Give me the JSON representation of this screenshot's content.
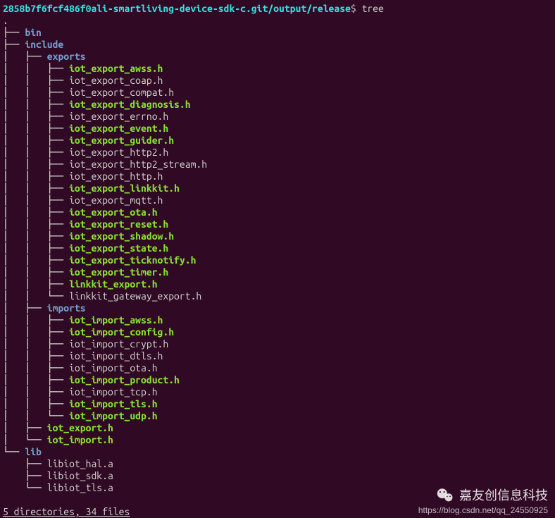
{
  "prompt": {
    "path": "2858b7f6fcf486f0ali-smartliving-device-sdk-c.git/output/release",
    "dollar": "$",
    "command": "tree"
  },
  "dot": ".",
  "tree": [
    {
      "prefix": "├── ",
      "name": "bin",
      "type": "dir"
    },
    {
      "prefix": "├── ",
      "name": "include",
      "type": "dir"
    },
    {
      "prefix": "│   ├── ",
      "name": "exports",
      "type": "dir"
    },
    {
      "prefix": "│   │   ├── ",
      "name": "iot_export_awss.h",
      "type": "file-hl"
    },
    {
      "prefix": "│   │   ├── ",
      "name": "iot_export_coap.h",
      "type": "file"
    },
    {
      "prefix": "│   │   ├── ",
      "name": "iot_export_compat.h",
      "type": "file"
    },
    {
      "prefix": "│   │   ├── ",
      "name": "iot_export_diagnosis.h",
      "type": "file-hl"
    },
    {
      "prefix": "│   │   ├── ",
      "name": "iot_export_errno.h",
      "type": "file"
    },
    {
      "prefix": "│   │   ├── ",
      "name": "iot_export_event.h",
      "type": "file-hl"
    },
    {
      "prefix": "│   │   ├── ",
      "name": "iot_export_guider.h",
      "type": "file-hl"
    },
    {
      "prefix": "│   │   ├── ",
      "name": "iot_export_http2.h",
      "type": "file"
    },
    {
      "prefix": "│   │   ├── ",
      "name": "iot_export_http2_stream.h",
      "type": "file"
    },
    {
      "prefix": "│   │   ├── ",
      "name": "iot_export_http.h",
      "type": "file"
    },
    {
      "prefix": "│   │   ├── ",
      "name": "iot_export_linkkit.h",
      "type": "file-hl"
    },
    {
      "prefix": "│   │   ├── ",
      "name": "iot_export_mqtt.h",
      "type": "file"
    },
    {
      "prefix": "│   │   ├── ",
      "name": "iot_export_ota.h",
      "type": "file-hl"
    },
    {
      "prefix": "│   │   ├── ",
      "name": "iot_export_reset.h",
      "type": "file-hl"
    },
    {
      "prefix": "│   │   ├── ",
      "name": "iot_export_shadow.h",
      "type": "file-hl"
    },
    {
      "prefix": "│   │   ├── ",
      "name": "iot_export_state.h",
      "type": "file-hl"
    },
    {
      "prefix": "│   │   ├── ",
      "name": "iot_export_ticknotify.h",
      "type": "file-hl"
    },
    {
      "prefix": "│   │   ├── ",
      "name": "iot_export_timer.h",
      "type": "file-hl"
    },
    {
      "prefix": "│   │   ├── ",
      "name": "linkkit_export.h",
      "type": "file-hl"
    },
    {
      "prefix": "│   │   └── ",
      "name": "linkkit_gateway_export.h",
      "type": "file"
    },
    {
      "prefix": "│   ├── ",
      "name": "imports",
      "type": "dir"
    },
    {
      "prefix": "│   │   ├── ",
      "name": "iot_import_awss.h",
      "type": "file-hl"
    },
    {
      "prefix": "│   │   ├── ",
      "name": "iot_import_config.h",
      "type": "file-hl"
    },
    {
      "prefix": "│   │   ├── ",
      "name": "iot_import_crypt.h",
      "type": "file"
    },
    {
      "prefix": "│   │   ├── ",
      "name": "iot_import_dtls.h",
      "type": "file"
    },
    {
      "prefix": "│   │   ├── ",
      "name": "iot_import_ota.h",
      "type": "file"
    },
    {
      "prefix": "│   │   ├── ",
      "name": "iot_import_product.h",
      "type": "file-hl"
    },
    {
      "prefix": "│   │   ├── ",
      "name": "iot_import_tcp.h",
      "type": "file"
    },
    {
      "prefix": "│   │   ├── ",
      "name": "iot_import_tls.h",
      "type": "file-hl"
    },
    {
      "prefix": "│   │   └── ",
      "name": "iot_import_udp.h",
      "type": "file-hl"
    },
    {
      "prefix": "│   ├── ",
      "name": "iot_export.h",
      "type": "file-hl"
    },
    {
      "prefix": "│   └── ",
      "name": "iot_import.h",
      "type": "file-hl"
    },
    {
      "prefix": "└── ",
      "name": "lib",
      "type": "dir"
    },
    {
      "prefix": "    ├── ",
      "name": "libiot_hal.a",
      "type": "file"
    },
    {
      "prefix": "    ├── ",
      "name": "libiot_sdk.a",
      "type": "file"
    },
    {
      "prefix": "    └── ",
      "name": "libiot_tls.a",
      "type": "file"
    }
  ],
  "summary": "5 directories, 34 files",
  "watermark": {
    "text": "嘉友创信息科技",
    "url": "https://blog.csdn.net/qq_24550925"
  }
}
